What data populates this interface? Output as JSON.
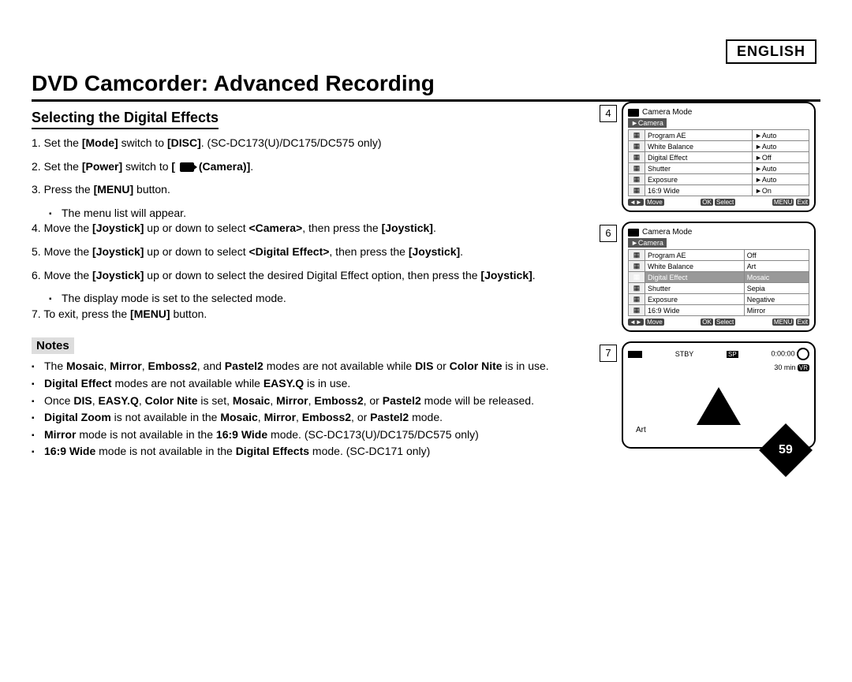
{
  "language_label": "ENGLISH",
  "title": "DVD Camcorder: Advanced Recording",
  "subtitle": "Selecting the Digital Effects",
  "steps": [
    {
      "n": "1.",
      "html": "Set the <b>[Mode]</b> switch to <b>[DISC]</b>. (SC-DC173(U)/DC175/DC575 only)"
    },
    {
      "n": "2.",
      "html": "Set the <b>[Power]</b> switch to <b>[ <span class='cam-icon' data-name='camera-icon' data-interactable='false'></span> (Camera)]</b>."
    },
    {
      "n": "3.",
      "html": "Press the <b>[MENU]</b> button.",
      "sub": "The menu list will appear."
    },
    {
      "n": "4.",
      "html": "Move the <b>[Joystick]</b> up or down to select <b>&lt;Camera&gt;</b>, then press the <b>[Joystick]</b>."
    },
    {
      "n": "5.",
      "html": "Move the <b>[Joystick]</b> up or down to select <b>&lt;Digital Effect&gt;</b>, then press the <b>[Joystick]</b>."
    },
    {
      "n": "6.",
      "html": "Move the <b>[Joystick]</b> up or down to select the desired Digital Effect option, then press the <b>[Joystick]</b>.",
      "sub": "The display mode is set to the selected mode."
    },
    {
      "n": "7.",
      "html": "To exit, press the <b>[MENU]</b> button."
    }
  ],
  "notes_label": "Notes",
  "notes": [
    "The <b>Mosaic</b>, <b>Mirror</b>, <b>Emboss2</b>, and <b>Pastel2</b> modes are not available while <b>DIS</b> or <b>Color Nite</b> is in use.",
    "<b>Digital Effect</b> modes are not available while <b>EASY.Q</b> is in use.",
    "Once <b>DIS</b>, <b>EASY.Q</b>, <b>Color Nite</b> is set, <b>Mosaic</b>, <b>Mirror</b>, <b>Emboss2</b>, or <b>Pastel2</b> mode will be released.",
    "<b>Digital Zoom</b> is not available in the <b>Mosaic</b>, <b>Mirror</b>, <b>Emboss2</b>, or <b>Pastel2</b> mode.",
    "<b>Mirror</b> mode is not available in the <b>16:9 Wide</b> mode. (SC-DC173(U)/DC175/DC575 only)",
    "<b>16:9 Wide</b> mode is not available in the <b>Digital Effects</b> mode. (SC-DC171 only)"
  ],
  "figures": {
    "fig4": {
      "num": "4",
      "mode_title": "Camera Mode",
      "header": "►Camera",
      "rows": [
        {
          "label": "Program AE",
          "val": "►Auto"
        },
        {
          "label": "White Balance",
          "val": "►Auto"
        },
        {
          "label": "Digital Effect",
          "val": "►Off"
        },
        {
          "label": "Shutter",
          "val": "►Auto"
        },
        {
          "label": "Exposure",
          "val": "►Auto"
        },
        {
          "label": "16:9 Wide",
          "val": "►On"
        }
      ],
      "nav": {
        "move": "Move",
        "select": "Select",
        "exit": "Exit"
      }
    },
    "fig6": {
      "num": "6",
      "mode_title": "Camera Mode",
      "header": "►Camera",
      "rows": [
        {
          "label": "Program AE",
          "val": "Off"
        },
        {
          "label": "White Balance",
          "val": "Art"
        },
        {
          "label": "Digital Effect",
          "val": "Mosaic",
          "hl": true
        },
        {
          "label": "Shutter",
          "val": "Sepia"
        },
        {
          "label": "Exposure",
          "val": "Negative"
        },
        {
          "label": "16:9 Wide",
          "val": "Mirror"
        }
      ],
      "nav": {
        "move": "Move",
        "select": "Select",
        "exit": "Exit"
      }
    },
    "fig7": {
      "num": "7",
      "stby": "STBY",
      "sp": "SP",
      "time": "0:00:00",
      "remain": "30 min",
      "vr": "VR",
      "label": "Art"
    }
  },
  "page_number": "59"
}
